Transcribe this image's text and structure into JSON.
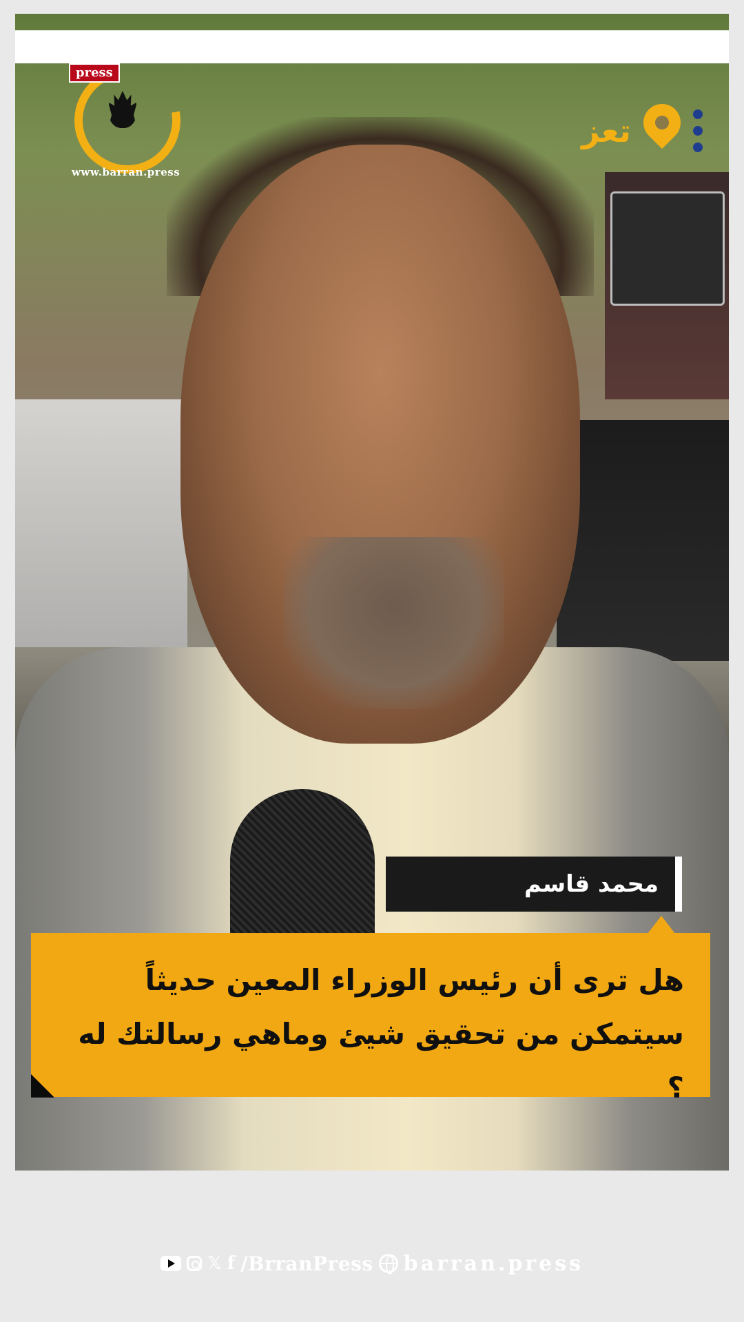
{
  "brand": {
    "press_tag": "press",
    "website_watermark": "www.barran.press"
  },
  "location": {
    "city": "تعز",
    "pin_color": "#f2b014"
  },
  "speaker": {
    "name": "محمد قاسم"
  },
  "question": {
    "text": "هل ترى أن رئيس الوزراء المعين حديثاً سيتمكن من تحقيق شيئ وماهي رسالتك له ؟"
  },
  "footer": {
    "social_handle": "/BrranPress",
    "website": "barran.press",
    "icons": [
      "youtube-icon",
      "instagram-icon",
      "x-icon",
      "facebook-icon",
      "globe-icon"
    ]
  },
  "colors": {
    "accent": "#f2a812",
    "name_box": "#1a1a1a"
  }
}
